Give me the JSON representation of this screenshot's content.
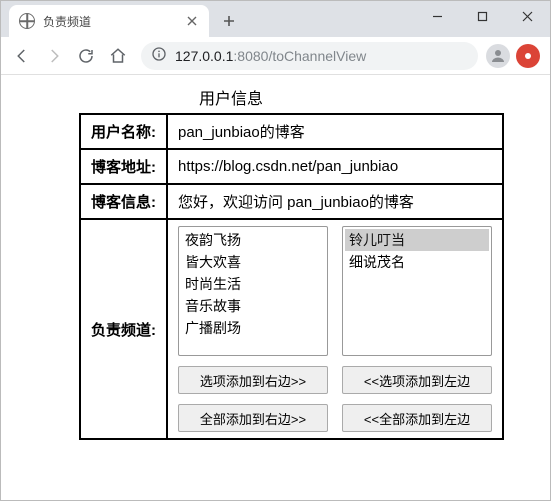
{
  "window": {
    "tab_title": "负责频道"
  },
  "toolbar": {
    "url_host": "127.0.0.1",
    "url_port": ":8080",
    "url_path": "/toChannelView"
  },
  "page": {
    "title": "用户信息",
    "labels": {
      "username": "用户名称:",
      "blog_url": "博客地址:",
      "blog_info": "博客信息:",
      "channels": "负责频道:"
    },
    "values": {
      "username": "pan_junbiao的博客",
      "blog_url": "https://blog.csdn.net/pan_junbiao",
      "blog_info": "您好，欢迎访问 pan_junbiao的博客"
    },
    "left_options": [
      "夜韵飞扬",
      "皆大欢喜",
      "时尚生活",
      "音乐故事",
      "广播剧场"
    ],
    "right_options": [
      "铃儿叮当",
      "细说茂名"
    ],
    "right_selected_index": 0,
    "buttons": {
      "add_right": "选项添加到右边>>",
      "all_right": "全部添加到右边>>",
      "add_left": "<<选项添加到左边",
      "all_left": "<<全部添加到左边"
    }
  }
}
